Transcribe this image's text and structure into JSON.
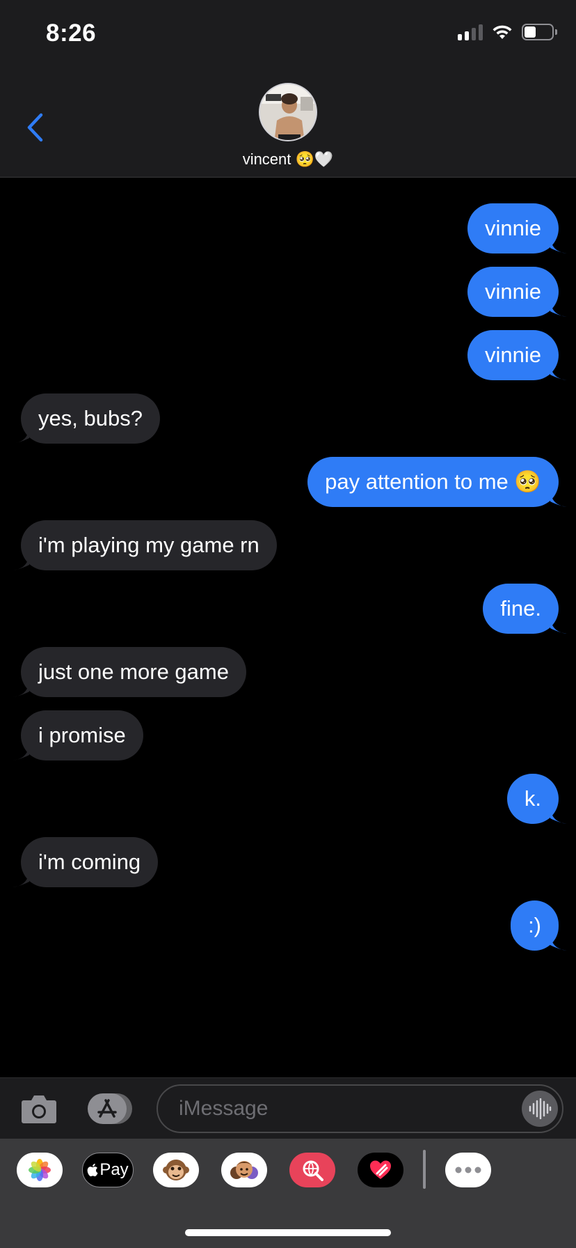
{
  "status_bar": {
    "time": "8:26",
    "icons": [
      "cellular-signal-icon",
      "wifi-icon",
      "battery-icon"
    ]
  },
  "header": {
    "back_icon": "chevron-left-icon",
    "contact_name": "vincent 🥺🤍",
    "avatar": "contact-avatar-photo"
  },
  "messages": [
    {
      "direction": "outgoing",
      "text": "vinnie"
    },
    {
      "direction": "outgoing",
      "text": "vinnie"
    },
    {
      "direction": "outgoing",
      "text": "vinnie"
    },
    {
      "direction": "incoming",
      "text": "yes, bubs?"
    },
    {
      "direction": "outgoing",
      "text": "pay attention to me 🥺"
    },
    {
      "direction": "incoming",
      "text": "i'm playing my game rn"
    },
    {
      "direction": "outgoing",
      "text": "fine."
    },
    {
      "direction": "incoming",
      "text": "just one more game"
    },
    {
      "direction": "incoming",
      "text": "i promise"
    },
    {
      "direction": "outgoing",
      "text": "k."
    },
    {
      "direction": "incoming",
      "text": "i'm coming"
    },
    {
      "direction": "outgoing",
      "text": ":)"
    }
  ],
  "input_bar": {
    "placeholder": "iMessage",
    "camera_icon": "camera-icon",
    "apps_icon": "app-store-icon",
    "audio_icon": "audio-waveform-icon"
  },
  "app_drawer": {
    "apps": [
      {
        "name": "photos-app-icon"
      },
      {
        "name": "apple-pay-app-icon",
        "label": "Pay"
      },
      {
        "name": "animoji-monkey-icon"
      },
      {
        "name": "memoji-stickers-icon"
      },
      {
        "name": "web-search-icon"
      },
      {
        "name": "digital-touch-icon"
      },
      {
        "name": "more-apps-icon"
      }
    ]
  },
  "colors": {
    "outgoing_bubble": "#2f7cf6",
    "incoming_bubble": "#26262a",
    "background": "#000000",
    "header_bg": "#1c1c1e",
    "accent": "#2f7cf6"
  }
}
